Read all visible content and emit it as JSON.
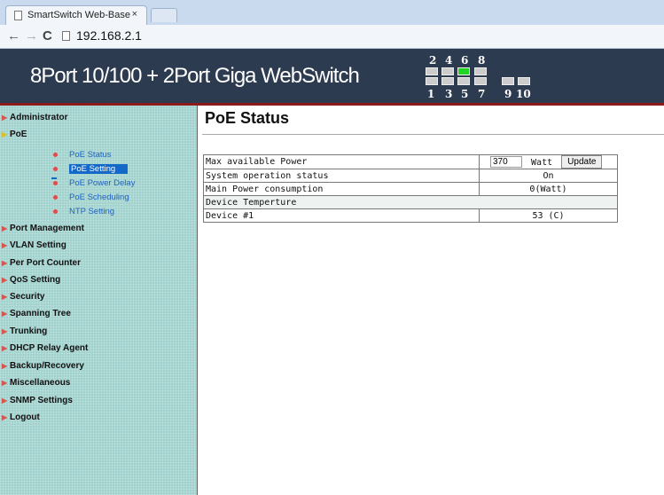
{
  "browser": {
    "tab_title": "SmartSwitch Web-Base",
    "tab_close": "×",
    "url": "192.168.2.1",
    "back": "←",
    "forward": "→",
    "reload": "C"
  },
  "header": {
    "brand": "8Port 10/100 + 2Port Giga WebSwitch",
    "ports_top": [
      "2",
      "4",
      "6",
      "8"
    ],
    "ports_bottom": [
      "1",
      "3",
      "5",
      "7",
      "9",
      "10"
    ],
    "active_port": "6"
  },
  "sidebar": {
    "items": [
      {
        "label": "Administrator"
      },
      {
        "label": "PoE"
      },
      {
        "label": "Port Management"
      },
      {
        "label": "VLAN Setting"
      },
      {
        "label": "Per Port Counter"
      },
      {
        "label": "QoS Setting"
      },
      {
        "label": "Security"
      },
      {
        "label": "Spanning Tree"
      },
      {
        "label": "Trunking"
      },
      {
        "label": "DHCP Relay Agent"
      },
      {
        "label": "Backup/Recovery"
      },
      {
        "label": "Miscellaneous"
      },
      {
        "label": "SNMP Settings"
      },
      {
        "label": "Logout"
      }
    ],
    "poe_sub": [
      {
        "label": "PoE Status"
      },
      {
        "label": "PoE Setting"
      },
      {
        "label": "PoE Power Delay"
      },
      {
        "label": "PoE Scheduling"
      },
      {
        "label": "NTP Setting"
      }
    ]
  },
  "main": {
    "title": "PoE Status",
    "max_power_label": "Max available Power",
    "max_power_value": "370",
    "max_power_unit": "Watt",
    "update_label": "Update",
    "system_status_label": "System operation status",
    "system_status_value": "On",
    "main_power_label": "Main Power consumption",
    "main_power_value": "0(Watt)",
    "device_temp_label": "Device Temperture",
    "device1_label": "Device #1",
    "device1_value": "53 (C)"
  },
  "colors": {
    "header_bg": "#2d3b50",
    "header_border": "#8b1a1a",
    "sidebar_bg": "#9fd1cd",
    "active_port": "#22d422",
    "submenu_link": "#1f62c4"
  }
}
